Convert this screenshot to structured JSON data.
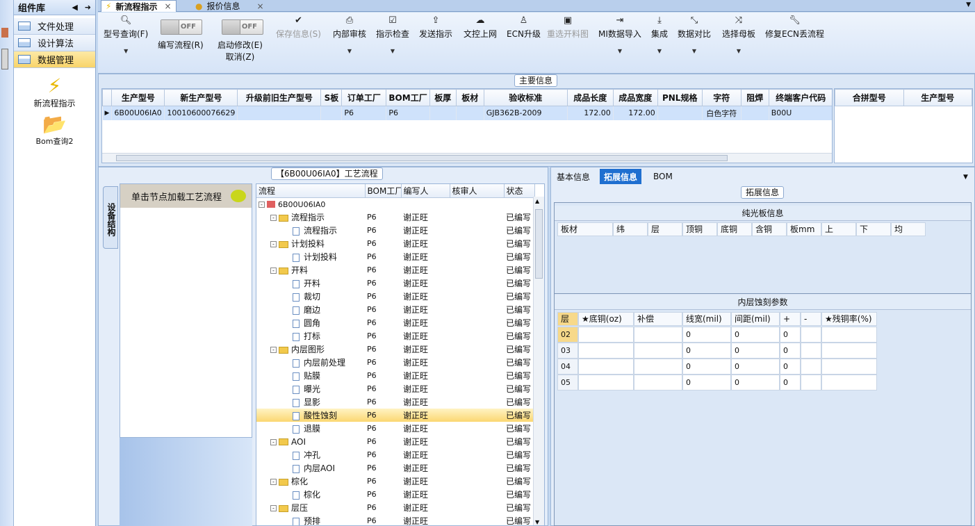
{
  "library": {
    "title": "组件库",
    "items": [
      {
        "label": "文件处理"
      },
      {
        "label": "设计算法"
      },
      {
        "label": "数据管理"
      }
    ],
    "shortcuts": [
      {
        "label": "新流程指示"
      },
      {
        "label": "Bom查询2"
      }
    ]
  },
  "tabs": [
    {
      "label": "新流程指示",
      "close": "×"
    },
    {
      "label": "报价信息",
      "close": "×"
    }
  ],
  "toolbar": {
    "buttons": [
      {
        "label": "型号查询(F)"
      },
      {
        "label": "编写流程(R)"
      },
      {
        "label": "启动修改(E)",
        "sub": "取消(Z)"
      },
      {
        "label": "保存信息(S)"
      },
      {
        "label": "内部审核"
      },
      {
        "label": "指示检查"
      },
      {
        "label": "发送指示"
      },
      {
        "label": "文控上网"
      },
      {
        "label": "ECN升级"
      },
      {
        "label": "重选开料图"
      },
      {
        "label": "MI数据导入"
      },
      {
        "label": "集成"
      },
      {
        "label": "数据对比"
      },
      {
        "label": "选择母板"
      },
      {
        "label": "修复ECN丢流程"
      }
    ],
    "toggle_off": "OFF"
  },
  "main_info": {
    "legend": "主要信息",
    "columns": [
      "生产型号",
      "新生产型号",
      "升级前旧生产型号",
      "S板",
      "订单工厂",
      "BOM工厂",
      "板厚",
      "板材",
      "验收标准",
      "成品长度",
      "成品宽度",
      "PNL规格",
      "字符",
      "阻焊",
      "终端客户代码"
    ],
    "row": [
      "6B00U06IA0",
      "10010600076629",
      "",
      "",
      "P6",
      "P6",
      "",
      "",
      "GJB362B-2009",
      "172.00",
      "172.00",
      "",
      "白色字符",
      "",
      "B00U"
    ],
    "right_columns": [
      "合拼型号",
      "生产型号"
    ]
  },
  "flow": {
    "legend": "【6B00U06IA0】工艺流程",
    "vtab": "设备结构",
    "node_hint": "单击节点加载工艺流程",
    "columns": [
      "流程",
      "BOM工厂",
      "编写人",
      "核审人",
      "状态"
    ],
    "root": "6B00U06IA0",
    "rows": [
      {
        "name": "流程指示",
        "type": "folder",
        "bom": "P6",
        "writer": "谢正旺",
        "status": "已编写"
      },
      {
        "name": "流程指示",
        "type": "doc",
        "bom": "P6",
        "writer": "谢正旺",
        "status": "已编写"
      },
      {
        "name": "计划投料",
        "type": "folder",
        "bom": "P6",
        "writer": "谢正旺",
        "status": "已编写"
      },
      {
        "name": "计划投料",
        "type": "doc",
        "bom": "P6",
        "writer": "谢正旺",
        "status": "已编写"
      },
      {
        "name": "开料",
        "type": "folder",
        "bom": "P6",
        "writer": "谢正旺",
        "status": "已编写"
      },
      {
        "name": "开料",
        "type": "doc",
        "bom": "P6",
        "writer": "谢正旺",
        "status": "已编写"
      },
      {
        "name": "裁切",
        "type": "doc",
        "bom": "P6",
        "writer": "谢正旺",
        "status": "已编写"
      },
      {
        "name": "磨边",
        "type": "doc",
        "bom": "P6",
        "writer": "谢正旺",
        "status": "已编写"
      },
      {
        "name": "圆角",
        "type": "doc",
        "bom": "P6",
        "writer": "谢正旺",
        "status": "已编写"
      },
      {
        "name": "打标",
        "type": "doc",
        "bom": "P6",
        "writer": "谢正旺",
        "status": "已编写"
      },
      {
        "name": "内层图形",
        "type": "folder",
        "bom": "P6",
        "writer": "谢正旺",
        "status": "已编写"
      },
      {
        "name": "内层前处理",
        "type": "doc",
        "bom": "P6",
        "writer": "谢正旺",
        "status": "已编写"
      },
      {
        "name": "贴膜",
        "type": "doc",
        "bom": "P6",
        "writer": "谢正旺",
        "status": "已编写"
      },
      {
        "name": "曝光",
        "type": "doc",
        "bom": "P6",
        "writer": "谢正旺",
        "status": "已编写"
      },
      {
        "name": "显影",
        "type": "doc",
        "bom": "P6",
        "writer": "谢正旺",
        "status": "已编写"
      },
      {
        "name": "酸性蚀刻",
        "type": "doc",
        "bom": "P6",
        "writer": "谢正旺",
        "status": "已编写",
        "selected": true
      },
      {
        "name": "退膜",
        "type": "doc",
        "bom": "P6",
        "writer": "谢正旺",
        "status": "已编写"
      },
      {
        "name": "AOI",
        "type": "folder",
        "bom": "P6",
        "writer": "谢正旺",
        "status": "已编写"
      },
      {
        "name": "冲孔",
        "type": "doc",
        "bom": "P6",
        "writer": "谢正旺",
        "status": "已编写"
      },
      {
        "name": "内层AOI",
        "type": "doc",
        "bom": "P6",
        "writer": "谢正旺",
        "status": "已编写"
      },
      {
        "name": "棕化",
        "type": "folder",
        "bom": "P6",
        "writer": "谢正旺",
        "status": "已编写"
      },
      {
        "name": "棕化",
        "type": "doc",
        "bom": "P6",
        "writer": "谢正旺",
        "status": "已编写"
      },
      {
        "name": "层压",
        "type": "folder",
        "bom": "P6",
        "writer": "谢正旺",
        "status": "已编写"
      },
      {
        "name": "预排",
        "type": "doc",
        "bom": "P6",
        "writer": "谢正旺",
        "status": "已编写"
      }
    ]
  },
  "right": {
    "tabs": [
      "基本信息",
      "拓展信息",
      "BOM"
    ],
    "legend": "拓展信息",
    "bare_board": {
      "title": "纯光板信息",
      "columns": [
        "板材",
        "纬",
        "层",
        "顶铜",
        "底铜",
        "含铜",
        "板mm",
        "上",
        "下",
        "均"
      ]
    },
    "inner_etch": {
      "title": "内层蚀刻参数",
      "columns": [
        "层",
        "★底铜(oz)",
        "补偿",
        "线宽(mil)",
        "间距(mil)",
        "+",
        "-",
        "★残铜率(%)"
      ],
      "rows": [
        [
          "02",
          "",
          "",
          "0",
          "0",
          "0",
          "",
          ""
        ],
        [
          "03",
          "",
          "",
          "0",
          "0",
          "0",
          "",
          ""
        ],
        [
          "04",
          "",
          "",
          "0",
          "0",
          "0",
          "",
          ""
        ],
        [
          "05",
          "",
          "",
          "0",
          "0",
          "0",
          "",
          ""
        ]
      ]
    }
  }
}
